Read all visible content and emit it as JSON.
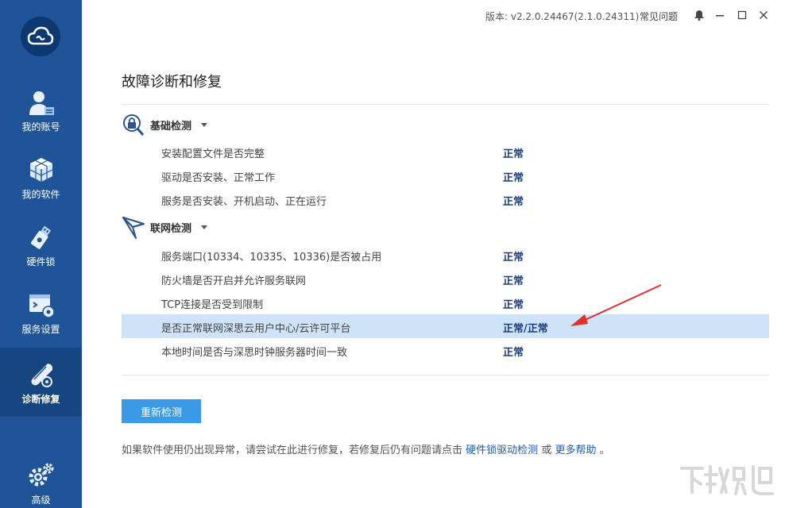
{
  "window": {
    "version": "版本: v2.2.0.24467(2.1.0.24311)",
    "faq": "常见问题"
  },
  "sidebar": {
    "items": [
      {
        "label": "我的账号",
        "icon": "user-account-icon"
      },
      {
        "label": "我的软件",
        "icon": "software-cube-icon"
      },
      {
        "label": "硬件锁",
        "icon": "usb-lock-icon"
      },
      {
        "label": "服务设置",
        "icon": "service-settings-icon"
      },
      {
        "label": "诊断修复",
        "icon": "diagnose-repair-icon",
        "active": true
      },
      {
        "label": "高级",
        "icon": "gears-icon"
      }
    ]
  },
  "main": {
    "title": "故障诊断和修复",
    "sections": [
      {
        "title": "基础检测",
        "icon": "magnifier-lock-icon",
        "rows": [
          {
            "name": "安装配置文件是否完整",
            "status": "正常"
          },
          {
            "name": "驱动是否安装、正常工作",
            "status": "正常"
          },
          {
            "name": "服务是否安装、开机启动、正在运行",
            "status": "正常"
          }
        ]
      },
      {
        "title": "联网检测",
        "icon": "paper-plane-icon",
        "rows": [
          {
            "name": "服务端口(10334、10335、10336)是否被占用",
            "status": "正常"
          },
          {
            "name": "防火墙是否开启并允许服务联网",
            "status": "正常"
          },
          {
            "name": "TCP连接是否受到限制",
            "status": "正常"
          },
          {
            "name": "是否正常联网深思云用户中心/云许可平台",
            "status": "正常/正常",
            "highlighted": true
          },
          {
            "name": "本地时间是否与深思时钟服务器时间一致",
            "status": "正常"
          }
        ]
      }
    ],
    "recheck_button": "重新检测",
    "footer": {
      "text": "如果软件使用仍出现异常，请尝试在此进行修复，若修复后仍有问题请点击",
      "link1": "硬件锁驱动检测",
      "or": "或",
      "link2": "更多帮助",
      "end": "。"
    }
  },
  "colors": {
    "sidebar": "#1f5499",
    "sidebar_active": "#15467f",
    "button": "#3a9ae6",
    "highlight_row": "#cfe3f8",
    "status_text": "#1a3f80",
    "arrow": "#e0312f"
  }
}
